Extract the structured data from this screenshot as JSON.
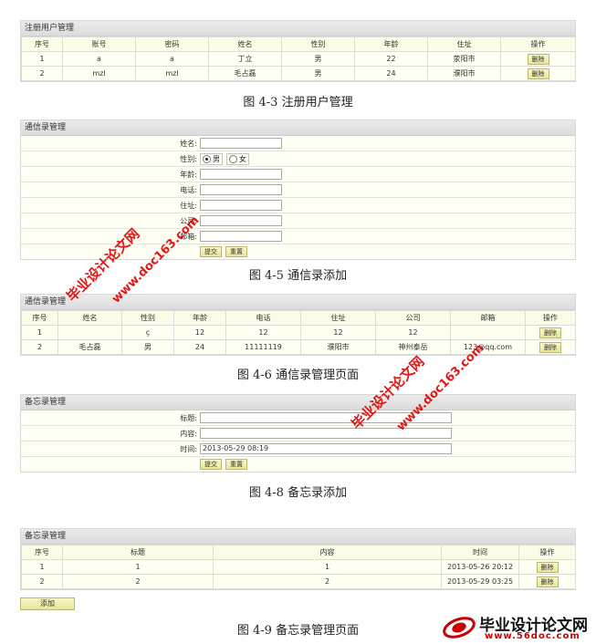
{
  "users": {
    "title": "注册用户管理",
    "headers": [
      "序号",
      "账号",
      "密码",
      "姓名",
      "性别",
      "年龄",
      "住址",
      "操作"
    ],
    "rows": [
      [
        "1",
        "a",
        "a",
        "丁立",
        "男",
        "22",
        "荥阳市"
      ],
      [
        "2",
        "mzl",
        "mzl",
        "毛占磊",
        "男",
        "24",
        "濮阳市"
      ]
    ],
    "action": "删除",
    "caption": "图 4-3 注册用户管理"
  },
  "contact_add": {
    "title": "通信录管理",
    "labels": {
      "name": "姓名:",
      "gender": "性别:",
      "age": "年龄:",
      "phone": "电话:",
      "address": "住址:",
      "company": "公司:",
      "email": "邮箱:"
    },
    "gender_options": {
      "male": "男",
      "female": "女"
    },
    "gender_selected": "男",
    "submit": "提交",
    "reset": "重置",
    "caption": "图 4-5 通信录添加"
  },
  "contacts": {
    "title": "通信录管理",
    "headers": [
      "序号",
      "姓名",
      "性别",
      "年龄",
      "电话",
      "住址",
      "公司",
      "邮箱",
      "操作"
    ],
    "rows": [
      [
        "1",
        "",
        "ç",
        "12",
        "12",
        "12",
        "12",
        ""
      ],
      [
        "2",
        "毛占磊",
        "男",
        "24",
        "11111119",
        "濮阳市",
        "神州泰岳",
        "123@qq.com"
      ]
    ],
    "action": "删除",
    "caption": "图 4-6 通信录管理页面"
  },
  "memo_add": {
    "title": "备忘录管理",
    "labels": {
      "title": "标题:",
      "content": "内容:",
      "time": "时间:"
    },
    "time_value": "2013-05-29 08:19",
    "submit": "提交",
    "reset": "重置",
    "caption": "图 4-8 备忘录添加"
  },
  "memos": {
    "title": "备忘录管理",
    "headers": [
      "序号",
      "标题",
      "内容",
      "时间",
      "操作"
    ],
    "rows": [
      [
        "1",
        "1",
        "1",
        "2013-05-26 20:12"
      ],
      [
        "2",
        "2",
        "2",
        "2013-05-29 03:25"
      ]
    ],
    "action": "删除",
    "add_button": "添加",
    "caption": "图 4-9 备忘录管理页面"
  },
  "watermarks": {
    "site_name": "毕业设计论文网",
    "site_url": "www.doc163.com",
    "logo_name": "毕业设计论文网",
    "logo_url": "www.56doc.com"
  },
  "colors": {
    "accent": "#fbf8c6",
    "watermark": "#dd0000"
  }
}
